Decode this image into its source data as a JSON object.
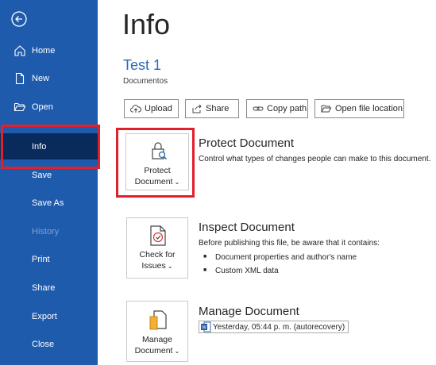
{
  "sidebar": {
    "items": [
      {
        "label": "Home",
        "icon": "home-icon",
        "enabled": true
      },
      {
        "label": "New",
        "icon": "new-document-icon",
        "enabled": true
      },
      {
        "label": "Open",
        "icon": "folder-open-icon",
        "enabled": true
      },
      {
        "label": "Info",
        "icon": "",
        "enabled": true,
        "active": true
      },
      {
        "label": "Save",
        "icon": "",
        "enabled": true
      },
      {
        "label": "Save As",
        "icon": "",
        "enabled": true
      },
      {
        "label": "History",
        "icon": "",
        "enabled": false
      },
      {
        "label": "Print",
        "icon": "",
        "enabled": true
      },
      {
        "label": "Share",
        "icon": "",
        "enabled": true
      },
      {
        "label": "Export",
        "icon": "",
        "enabled": true
      },
      {
        "label": "Close",
        "icon": "",
        "enabled": true
      }
    ]
  },
  "main": {
    "title": "Info",
    "doc_name": "Test 1",
    "doc_location": "Documentos",
    "actions": [
      {
        "label": "Upload",
        "icon": "upload-icon"
      },
      {
        "label": "Share",
        "icon": "share-icon"
      },
      {
        "label": "Copy path",
        "icon": "link-icon"
      },
      {
        "label": "Open file location",
        "icon": "folder-open-icon"
      }
    ],
    "protect": {
      "tile_line1": "Protect",
      "tile_line2": "Document",
      "title": "Protect Document",
      "desc": "Control what types of changes people can make to this document."
    },
    "inspect": {
      "tile_line1": "Check for",
      "tile_line2": "Issues",
      "title": "Inspect Document",
      "desc": "Before publishing this file, be aware that it contains:",
      "bullets": [
        "Document properties and author's name",
        "Custom XML data"
      ]
    },
    "manage": {
      "tile_line1": "Manage",
      "tile_line2": "Document",
      "title": "Manage Document",
      "recovery": "Yesterday, 05:44 p. m. (autorecovery)"
    }
  },
  "colors": {
    "sidebar": "#1f5bad",
    "active": "#092b5c",
    "highlight": "#e0202b",
    "doc_name": "#2b6ab8"
  }
}
